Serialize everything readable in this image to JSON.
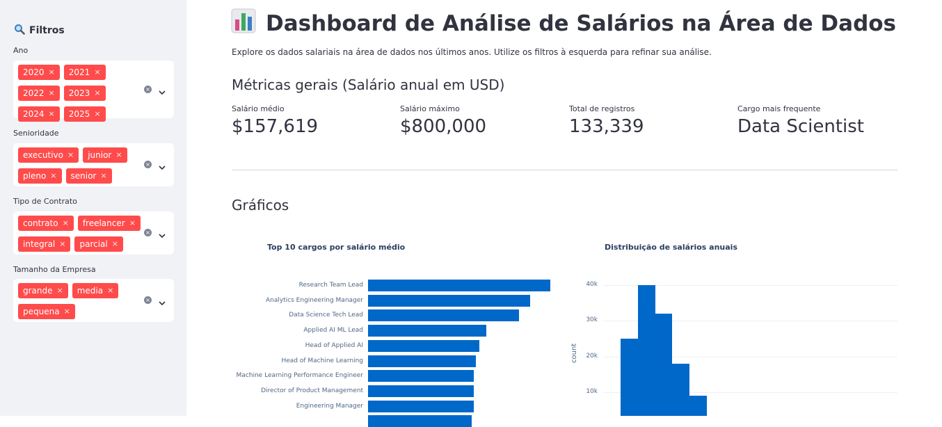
{
  "sidebar": {
    "title": "Filtros",
    "title_icon": "magnifier-icon",
    "filters": [
      {
        "label": "Ano",
        "chips": [
          "2020",
          "2021",
          "2022",
          "2023",
          "2024",
          "2025"
        ]
      },
      {
        "label": "Senioridade",
        "chips": [
          "executivo",
          "junior",
          "pleno",
          "senior"
        ]
      },
      {
        "label": "Tipo de Contrato",
        "chips": [
          "contrato",
          "freelancer",
          "integral",
          "parcial"
        ]
      },
      {
        "label": "Tamanho da Empresa",
        "chips": [
          "grande",
          "media",
          "pequena"
        ]
      }
    ],
    "chip_close": "×",
    "clear_symbol": "×"
  },
  "header": {
    "title": "Dashboard de Análise de Salários na Área de Dados",
    "title_icon": "bar-chart-icon",
    "subtitle": "Explore os dados salariais na área de dados nos últimos anos. Utilize os filtros à esquerda para refinar sua análise."
  },
  "metrics": {
    "heading": "Métricas gerais (Salário anual em USD)",
    "items": [
      {
        "label": "Salário médio",
        "value": "$157,619"
      },
      {
        "label": "Salário máximo",
        "value": "$800,000"
      },
      {
        "label": "Total de registros",
        "value": "133,339"
      },
      {
        "label": "Cargo mais frequente",
        "value": "Data Scientist"
      }
    ]
  },
  "charts_heading": "Gráficos",
  "colors": {
    "accent": "#ff4b4b",
    "bar": "#0068c9",
    "sidebar_bg": "#f0f2f6"
  },
  "chart_data": [
    {
      "type": "bar",
      "orientation": "horizontal",
      "title": "Top 10 cargos por salário médio",
      "categories": [
        "Research Team Lead",
        "Analytics Engineering Manager",
        "Data Science Tech Lead",
        "Applied AI ML Lead",
        "Head of Applied AI",
        "Head of Machine Learning",
        "Machine Learning Performance Engineer",
        "Director of Product Management",
        "Engineering Manager"
      ],
      "values": [
        1.0,
        0.89,
        0.83,
        0.65,
        0.61,
        0.59,
        0.58,
        0.58,
        0.58
      ],
      "value_scale": "relative to longest bar (axis values not visible)"
    },
    {
      "type": "bar",
      "subtype": "histogram",
      "title": "Distribuição de salários anuais",
      "ylabel": "count",
      "yticks": [
        "10k",
        "20k",
        "30k",
        "40k"
      ],
      "ylim": [
        0,
        40000
      ],
      "values": [
        25000,
        40000,
        32000,
        18000,
        9000
      ]
    }
  ]
}
